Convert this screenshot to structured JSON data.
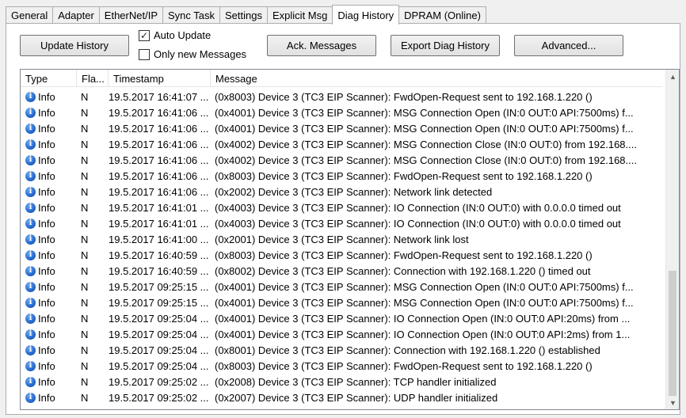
{
  "tabs": [
    {
      "label": "General"
    },
    {
      "label": "Adapter"
    },
    {
      "label": "EtherNet/IP"
    },
    {
      "label": "Sync Task"
    },
    {
      "label": "Settings"
    },
    {
      "label": "Explicit Msg"
    },
    {
      "label": "Diag History",
      "active": true
    },
    {
      "label": "DPRAM (Online)"
    }
  ],
  "toolbar": {
    "update_history": "Update History",
    "auto_update": {
      "label": "Auto Update",
      "checked": true
    },
    "only_new": {
      "label": "Only new Messages",
      "checked": false
    },
    "ack_messages": "Ack. Messages",
    "export": "Export Diag History",
    "advanced": "Advanced..."
  },
  "table": {
    "columns": [
      "Type",
      "Fla...",
      "Timestamp",
      "Message"
    ],
    "rows": [
      {
        "type": "Info",
        "flag": "N",
        "timestamp": "19.5.2017 16:41:07 ...",
        "message": "(0x8003) Device 3 (TC3 EIP Scanner): FwdOpen-Request sent to 192.168.1.220 ()"
      },
      {
        "type": "Info",
        "flag": "N",
        "timestamp": "19.5.2017 16:41:06 ...",
        "message": "(0x4001) Device 3 (TC3 EIP Scanner): MSG Connection Open (IN:0 OUT:0 API:7500ms) f..."
      },
      {
        "type": "Info",
        "flag": "N",
        "timestamp": "19.5.2017 16:41:06 ...",
        "message": "(0x4001) Device 3 (TC3 EIP Scanner): MSG Connection Open (IN:0 OUT:0 API:7500ms) f..."
      },
      {
        "type": "Info",
        "flag": "N",
        "timestamp": "19.5.2017 16:41:06 ...",
        "message": "(0x4002) Device 3 (TC3 EIP Scanner): MSG Connection Close (IN:0 OUT:0) from 192.168...."
      },
      {
        "type": "Info",
        "flag": "N",
        "timestamp": "19.5.2017 16:41:06 ...",
        "message": "(0x4002) Device 3 (TC3 EIP Scanner): MSG Connection Close (IN:0 OUT:0) from 192.168...."
      },
      {
        "type": "Info",
        "flag": "N",
        "timestamp": "19.5.2017 16:41:06 ...",
        "message": "(0x8003) Device 3 (TC3 EIP Scanner): FwdOpen-Request sent to 192.168.1.220 ()"
      },
      {
        "type": "Info",
        "flag": "N",
        "timestamp": "19.5.2017 16:41:06 ...",
        "message": "(0x2002) Device 3 (TC3 EIP Scanner): Network link detected"
      },
      {
        "type": "Info",
        "flag": "N",
        "timestamp": "19.5.2017 16:41:01 ...",
        "message": "(0x4003) Device 3 (TC3 EIP Scanner): IO Connection (IN:0 OUT:0) with 0.0.0.0 timed out"
      },
      {
        "type": "Info",
        "flag": "N",
        "timestamp": "19.5.2017 16:41:01 ...",
        "message": "(0x4003) Device 3 (TC3 EIP Scanner): IO Connection (IN:0 OUT:0) with 0.0.0.0 timed out"
      },
      {
        "type": "Info",
        "flag": "N",
        "timestamp": "19.5.2017 16:41:00 ...",
        "message": "(0x2001) Device 3 (TC3 EIP Scanner): Network link lost"
      },
      {
        "type": "Info",
        "flag": "N",
        "timestamp": "19.5.2017 16:40:59 ...",
        "message": "(0x8003) Device 3 (TC3 EIP Scanner): FwdOpen-Request sent to 192.168.1.220 ()"
      },
      {
        "type": "Info",
        "flag": "N",
        "timestamp": "19.5.2017 16:40:59 ...",
        "message": "(0x8002) Device 3 (TC3 EIP Scanner): Connection with 192.168.1.220 () timed out"
      },
      {
        "type": "Info",
        "flag": "N",
        "timestamp": "19.5.2017 09:25:15 ...",
        "message": "(0x4001) Device 3 (TC3 EIP Scanner): MSG Connection Open (IN:0 OUT:0 API:7500ms) f..."
      },
      {
        "type": "Info",
        "flag": "N",
        "timestamp": "19.5.2017 09:25:15 ...",
        "message": "(0x4001) Device 3 (TC3 EIP Scanner): MSG Connection Open (IN:0 OUT:0 API:7500ms) f..."
      },
      {
        "type": "Info",
        "flag": "N",
        "timestamp": "19.5.2017 09:25:04 ...",
        "message": "(0x4001) Device 3 (TC3 EIP Scanner): IO Connection Open (IN:0 OUT:0 API:20ms) from ..."
      },
      {
        "type": "Info",
        "flag": "N",
        "timestamp": "19.5.2017 09:25:04 ...",
        "message": "(0x4001) Device 3 (TC3 EIP Scanner): IO Connection Open (IN:0 OUT:0 API:2ms) from 1..."
      },
      {
        "type": "Info",
        "flag": "N",
        "timestamp": "19.5.2017 09:25:04 ...",
        "message": "(0x8001) Device 3 (TC3 EIP Scanner): Connection with 192.168.1.220 () established"
      },
      {
        "type": "Info",
        "flag": "N",
        "timestamp": "19.5.2017 09:25:04 ...",
        "message": "(0x8003) Device 3 (TC3 EIP Scanner): FwdOpen-Request sent to 192.168.1.220 ()"
      },
      {
        "type": "Info",
        "flag": "N",
        "timestamp": "19.5.2017 09:25:02 ...",
        "message": "(0x2008) Device 3 (TC3 EIP Scanner): TCP handler initialized"
      },
      {
        "type": "Info",
        "flag": "N",
        "timestamp": "19.5.2017 09:25:02 ...",
        "message": "(0x2007) Device 3 (TC3 EIP Scanner): UDP handler initialized"
      }
    ]
  },
  "scrollbar": {
    "icons": [
      "scroll-up-arrow",
      "scroll-down-arrow"
    ]
  }
}
